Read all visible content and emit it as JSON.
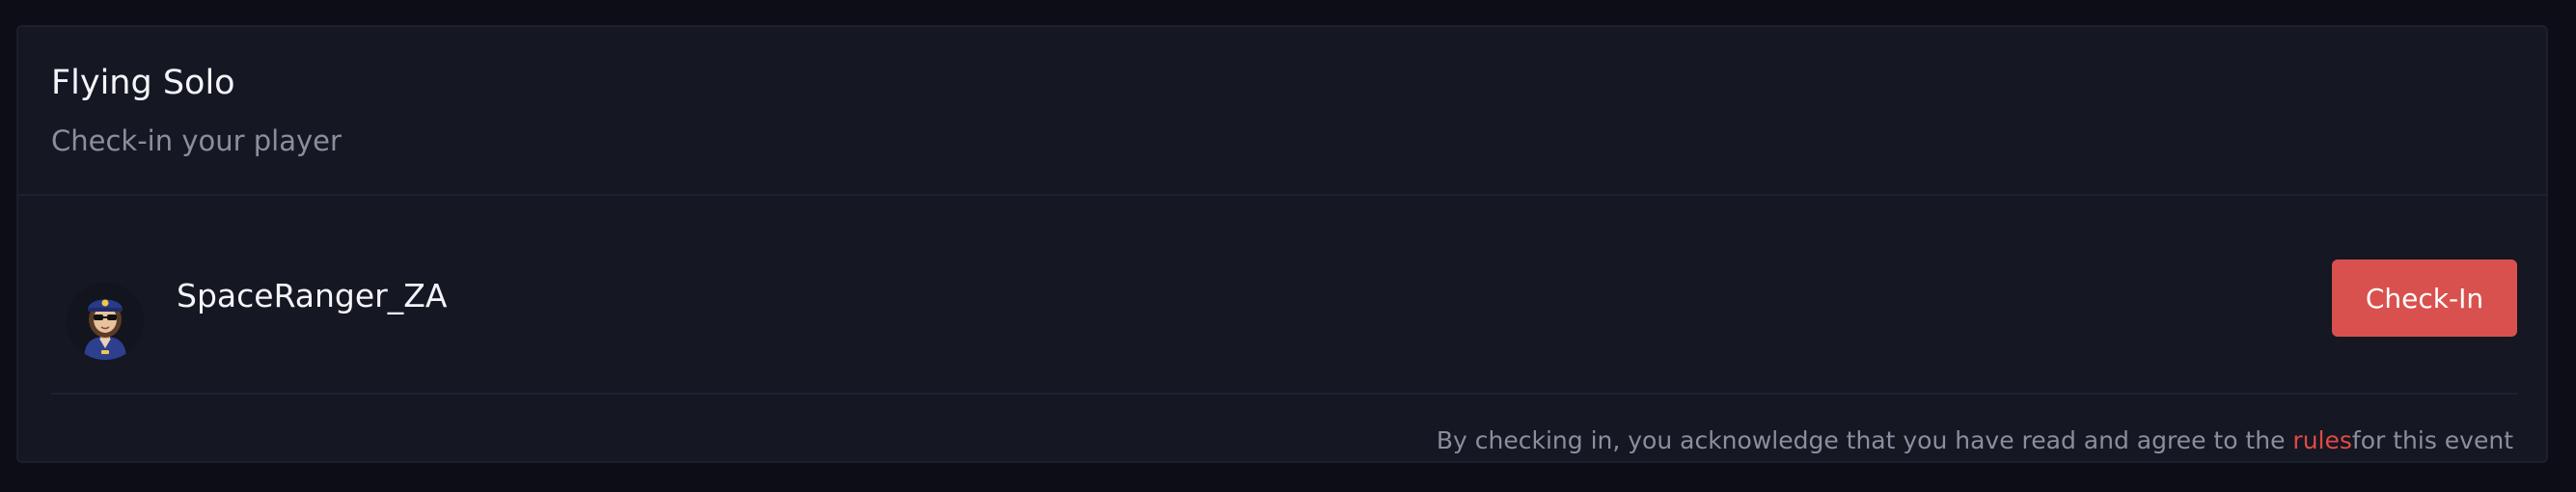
{
  "card": {
    "title": "Flying Solo",
    "subtitle": "Check-in your player"
  },
  "player": {
    "name": "SpaceRanger_ZA",
    "avatar_icon": "astronaut-avatar-icon"
  },
  "actions": {
    "checkin_label": "Check-In"
  },
  "footer": {
    "prefix": "By checking in, you acknowledge that you have read and agree to the ",
    "rules_link": "rules",
    "suffix": "for this event"
  },
  "colors": {
    "background": "#0c0d16",
    "card": "#151722",
    "accent": "#d9514e",
    "link": "#e04a45",
    "text_primary": "#f4f5f9",
    "text_muted": "#8a8e9e"
  }
}
